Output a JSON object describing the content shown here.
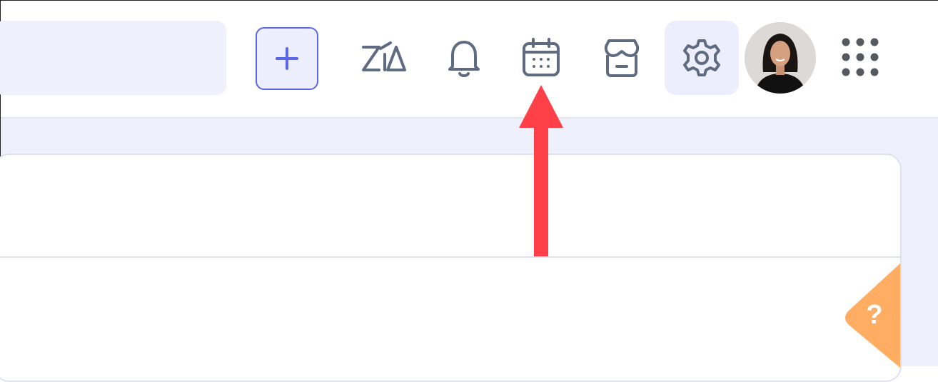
{
  "header": {
    "create_button": {
      "icon": "plus-icon"
    },
    "icons": [
      {
        "name": "zia-icon",
        "label": "Zia"
      },
      {
        "name": "bell-icon"
      },
      {
        "name": "calendar-icon"
      },
      {
        "name": "store-icon"
      },
      {
        "name": "gear-icon",
        "active": true
      },
      {
        "name": "avatar"
      },
      {
        "name": "apps-grid-icon"
      }
    ],
    "zia_text": "ZiA"
  },
  "annotation": {
    "type": "arrow",
    "color": "#ff4048",
    "points_to": "calendar-icon"
  },
  "help": {
    "label": "?",
    "color": "#ffad63"
  },
  "colors": {
    "accent": "#5a67e4",
    "icon": "#5f6b80",
    "page_bg": "#eef0fb",
    "arrow": "#ff4048",
    "help": "#ffad63"
  }
}
